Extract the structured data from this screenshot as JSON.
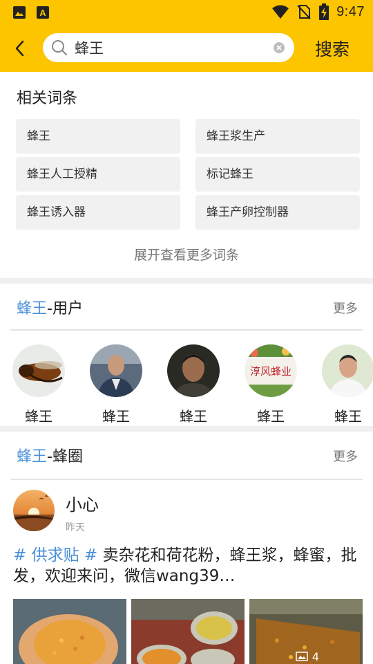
{
  "status_bar": {
    "time": "9:47"
  },
  "search": {
    "value": "蜂王",
    "button_label": "搜索"
  },
  "related": {
    "title": "相关词条",
    "items": [
      "蜂王",
      "蜂王浆生产",
      "蜂王人工授精",
      "标记蜂王",
      "蜂王诱入器",
      "蜂王产卵控制器"
    ],
    "expand_label": "展开查看更多词条"
  },
  "users_section": {
    "keyword": "蜂王",
    "suffix": "-用户",
    "more_label": "更多",
    "users": [
      {
        "name": "蜂王"
      },
      {
        "name": "蜂王"
      },
      {
        "name": "蜂王"
      },
      {
        "name": "蜂王",
        "avatar_text": "淳风蜂业"
      },
      {
        "name": "蜂王"
      }
    ]
  },
  "circle_section": {
    "keyword": "蜂王",
    "suffix": "-蜂圈",
    "more_label": "更多",
    "post": {
      "author": "小心",
      "time": "昨天",
      "topic": "# 供求贴 #",
      "text": " 卖杂花和荷花粉，蜂王浆，蜂蜜，批发，欢迎来问，微信wang39…",
      "image_count": "4"
    }
  },
  "colors": {
    "accent": "#fdc400",
    "highlight": "#4a90d9"
  }
}
